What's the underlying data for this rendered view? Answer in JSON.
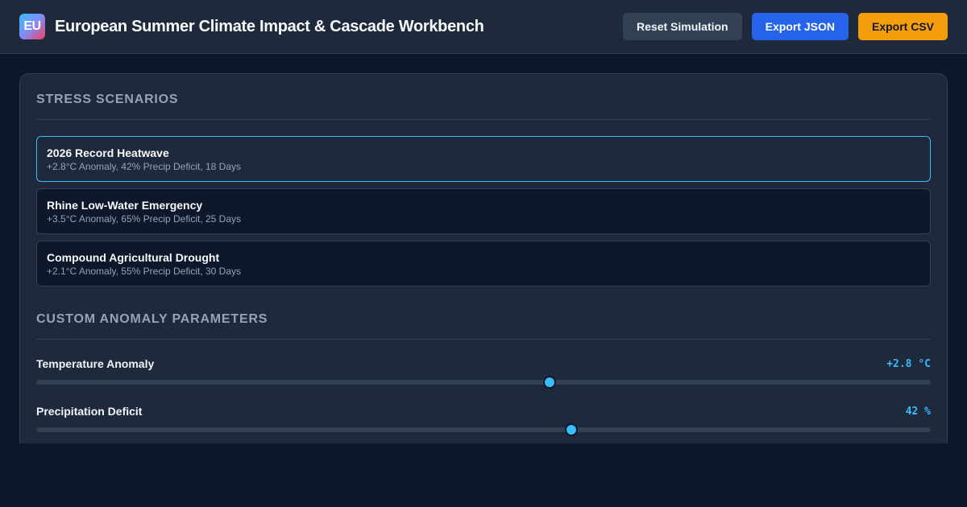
{
  "header": {
    "logo_text": "EU",
    "title": "European Summer Climate Impact & Cascade Workbench",
    "buttons": {
      "reset": "Reset Simulation",
      "export_json": "Export JSON",
      "export_csv": "Export CSV"
    }
  },
  "scenarios": {
    "title": "Stress Scenarios",
    "items": [
      {
        "name": "2026 Record Heatwave",
        "desc": "+2.8°C Anomaly, 42% Precip Deficit, 18 Days",
        "active": true
      },
      {
        "name": "Rhine Low-Water Emergency",
        "desc": "+3.5°C Anomaly, 65% Precip Deficit, 25 Days",
        "active": false
      },
      {
        "name": "Compound Agricultural Drought",
        "desc": "+2.1°C Anomaly, 55% Precip Deficit, 30 Days",
        "active": false
      }
    ]
  },
  "params": {
    "title": "Custom Anomaly Parameters",
    "temperature": {
      "label": "Temperature Anomaly",
      "value_text": "+2.8 °C",
      "fraction": 0.574
    },
    "precipitation": {
      "label": "Precipitation Deficit",
      "value_text": "42 %",
      "fraction": 0.598
    }
  },
  "colors": {
    "accent": "#38bdf8",
    "primary": "#2563eb",
    "warning": "#f59e0b",
    "background": "#0f172a",
    "surface": "#1e293b"
  },
  "icons": {
    "logo": "eu-logo-icon"
  }
}
